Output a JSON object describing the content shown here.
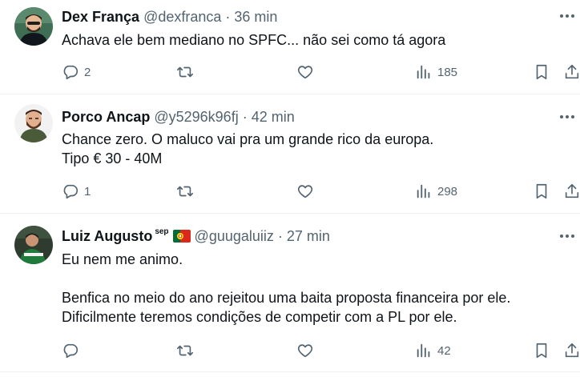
{
  "tweets": [
    {
      "display_name": "Dex França",
      "handle": "@dexfranca",
      "separator": "·",
      "time": "36 min",
      "lines": [
        "Achava ele bem mediano no SPFC... não sei como tá agora"
      ],
      "replies": "2",
      "views": "185"
    },
    {
      "display_name": "Porco Ancap",
      "handle": "@y5296k96fj",
      "separator": "·",
      "time": "42 min",
      "lines": [
        "Chance zero. O maluco vai pra um grande rico da europa.",
        "Tipo € 30 - 40M"
      ],
      "replies": "1",
      "views": "298"
    },
    {
      "display_name": "Luiz Augusto",
      "badge": "sep",
      "handle": "@guugaluiiz",
      "separator": "·",
      "time": "27 min",
      "lines": [
        "Eu nem me animo.",
        "",
        "Benfica no meio do ano rejeitou uma baita proposta financeira por ele.",
        "Dificilmente teremos condições de competir com a PL por ele."
      ],
      "replies": "",
      "views": "42"
    }
  ],
  "icons": {
    "reply": "reply-icon",
    "retweet": "retweet-icon",
    "like": "heart-icon",
    "views": "views-icon",
    "bookmark": "bookmark-icon",
    "share": "share-icon",
    "more": "more-icon",
    "flag": "portugal-flag-icon"
  },
  "colors": {
    "text": "#0f1419",
    "secondary": "#536471",
    "divider": "#eff3f4"
  }
}
